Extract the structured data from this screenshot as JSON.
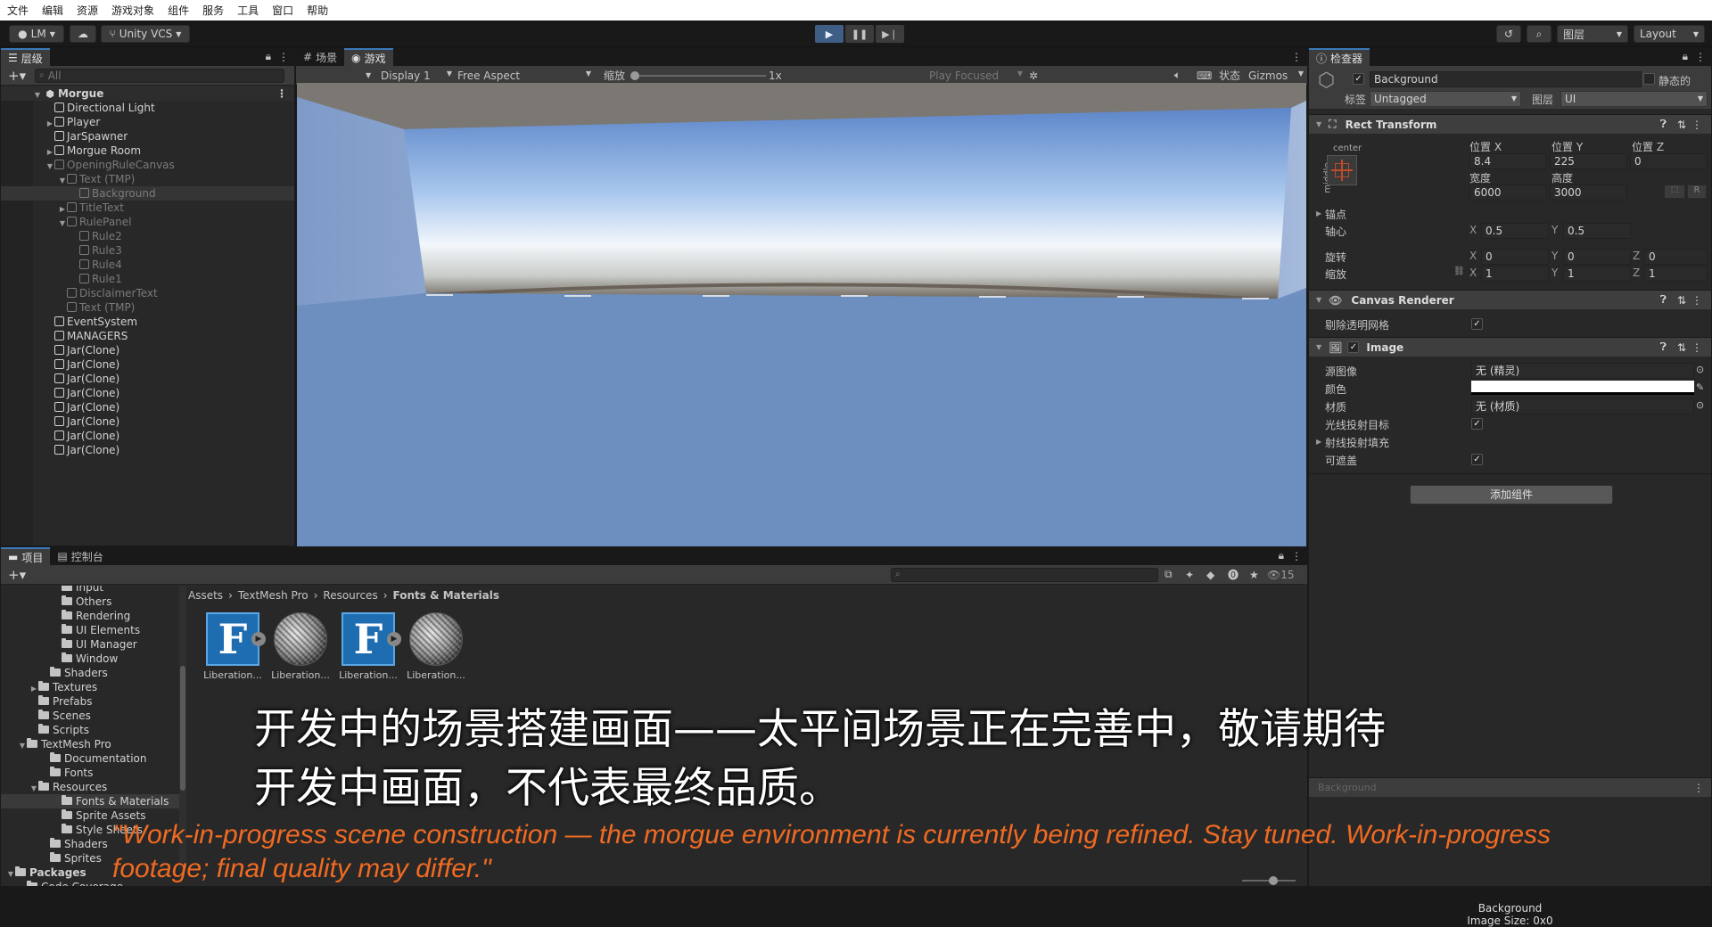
{
  "menubar": [
    "文件",
    "编辑",
    "资源",
    "游戏对象",
    "组件",
    "服务",
    "工具",
    "窗口",
    "帮助"
  ],
  "toolbar": {
    "account": "LM",
    "vcs": "Unity VCS",
    "layers": "图层",
    "layout": "Layout"
  },
  "hierarchy": {
    "tab": "层级",
    "search_placeholder": "All",
    "scene": "Morgue",
    "items": [
      {
        "label": "Directional Light",
        "indent": 1,
        "arrow": "",
        "dim": false
      },
      {
        "label": "Player",
        "indent": 1,
        "arrow": "▶",
        "dim": false
      },
      {
        "label": "JarSpawner",
        "indent": 1,
        "arrow": "",
        "dim": false
      },
      {
        "label": "Morgue Room",
        "indent": 1,
        "arrow": "▶",
        "dim": false
      },
      {
        "label": "OpeningRuleCanvas",
        "indent": 1,
        "arrow": "▼",
        "dim": true
      },
      {
        "label": "Text (TMP)",
        "indent": 2,
        "arrow": "▼",
        "dim": true
      },
      {
        "label": "Background",
        "indent": 3,
        "arrow": "",
        "dim": true,
        "selected": true
      },
      {
        "label": "TitleText",
        "indent": 2,
        "arrow": "▶",
        "dim": true
      },
      {
        "label": "RulePanel",
        "indent": 2,
        "arrow": "▼",
        "dim": true
      },
      {
        "label": "Rule2",
        "indent": 3,
        "arrow": "",
        "dim": true
      },
      {
        "label": "Rule3",
        "indent": 3,
        "arrow": "",
        "dim": true
      },
      {
        "label": "Rule4",
        "indent": 3,
        "arrow": "",
        "dim": true
      },
      {
        "label": "Rule1",
        "indent": 3,
        "arrow": "",
        "dim": true
      },
      {
        "label": "DisclaimerText",
        "indent": 2,
        "arrow": "",
        "dim": true
      },
      {
        "label": "Text (TMP)",
        "indent": 2,
        "arrow": "",
        "dim": true
      },
      {
        "label": "EventSystem",
        "indent": 1,
        "arrow": "",
        "dim": false
      },
      {
        "label": "MANAGERS",
        "indent": 1,
        "arrow": "",
        "dim": false
      },
      {
        "label": "Jar(Clone)",
        "indent": 1,
        "arrow": "",
        "dim": false
      },
      {
        "label": "Jar(Clone)",
        "indent": 1,
        "arrow": "",
        "dim": false
      },
      {
        "label": "Jar(Clone)",
        "indent": 1,
        "arrow": "",
        "dim": false
      },
      {
        "label": "Jar(Clone)",
        "indent": 1,
        "arrow": "",
        "dim": false
      },
      {
        "label": "Jar(Clone)",
        "indent": 1,
        "arrow": "",
        "dim": false
      },
      {
        "label": "Jar(Clone)",
        "indent": 1,
        "arrow": "",
        "dim": false
      },
      {
        "label": "Jar(Clone)",
        "indent": 1,
        "arrow": "",
        "dim": false
      },
      {
        "label": "Jar(Clone)",
        "indent": 1,
        "arrow": "",
        "dim": false
      }
    ]
  },
  "game": {
    "tab_scene": "场景",
    "tab_game": "游戏",
    "display": "Display 1",
    "aspect": "Free Aspect",
    "scale_label": "缩放",
    "scale_value": "1x",
    "play_focused": "Play Focused",
    "stats": "状态",
    "gizmos": "Gizmos"
  },
  "inspector": {
    "tab": "检查器",
    "object_name": "Background",
    "static": "静态的",
    "tag_label": "标签",
    "tag": "Untagged",
    "layer_label": "图层",
    "layer": "UI",
    "rect": {
      "title": "Rect Transform",
      "anchor_h": "center",
      "anchor_v": "middle",
      "pos_x_label": "位置 X",
      "pos_y_label": "位置 Y",
      "pos_z_label": "位置 Z",
      "pos_x": "8.4",
      "pos_y": "225",
      "pos_z": "0",
      "width_label": "宽度",
      "height_label": "高度",
      "width": "6000",
      "height": "3000",
      "anchors": "锚点",
      "pivot": "轴心",
      "pivot_x": "0.5",
      "pivot_y": "0.5",
      "rotation": "旋转",
      "rot_x": "0",
      "rot_y": "0",
      "rot_z": "0",
      "scale": "缩放",
      "scale_x": "1",
      "scale_y": "1",
      "scale_z": "1",
      "x": "X",
      "y": "Y",
      "z": "Z",
      "r": "R"
    },
    "canvas_renderer": {
      "title": "Canvas Renderer",
      "cull": "剔除透明网格"
    },
    "image": {
      "title": "Image",
      "source_label": "源图像",
      "source": "无 (精灵)",
      "color_label": "颜色",
      "material_label": "材质",
      "material": "无 (材质)",
      "raycast_target": "光线投射目标",
      "raycast_padding": "射线投射填充",
      "maskable": "可遮盖"
    },
    "add_component": "添加组件",
    "preview_label": "Background",
    "preview_name": "Background",
    "preview_size": "Image Size: 0x0"
  },
  "project": {
    "tab_project": "项目",
    "tab_console": "控制台",
    "count": "15",
    "breadcrumb": [
      "Assets",
      "TextMesh Pro",
      "Resources",
      "Fonts & Materials"
    ],
    "tree": [
      {
        "label": "Input",
        "indent": 4
      },
      {
        "label": "Others",
        "indent": 4
      },
      {
        "label": "Rendering",
        "indent": 4
      },
      {
        "label": "UI Elements",
        "indent": 4
      },
      {
        "label": "UI Manager",
        "indent": 4
      },
      {
        "label": "Window",
        "indent": 4
      },
      {
        "label": "Shaders",
        "indent": 3
      },
      {
        "label": "Textures",
        "indent": 2,
        "arrow": "▶"
      },
      {
        "label": "Prefabs",
        "indent": 2
      },
      {
        "label": "Scenes",
        "indent": 2
      },
      {
        "label": "Scripts",
        "indent": 2
      },
      {
        "label": "TextMesh Pro",
        "indent": 1,
        "arrow": "▼"
      },
      {
        "label": "Documentation",
        "indent": 3
      },
      {
        "label": "Fonts",
        "indent": 3
      },
      {
        "label": "Resources",
        "indent": 2,
        "arrow": "▼"
      },
      {
        "label": "Fonts & Materials",
        "indent": 4,
        "selected": true
      },
      {
        "label": "Sprite Assets",
        "indent": 4
      },
      {
        "label": "Style Sheets",
        "indent": 4
      },
      {
        "label": "Shaders",
        "indent": 3
      },
      {
        "label": "Sprites",
        "indent": 3
      },
      {
        "label": "Packages",
        "indent": 0,
        "arrow": "▼",
        "bold": true
      },
      {
        "label": "Code Coverage",
        "indent": 1,
        "arrow": "▶"
      }
    ],
    "assets": [
      {
        "label": "Liberation...",
        "kind": "font"
      },
      {
        "label": "Liberation...",
        "kind": "material"
      },
      {
        "label": "Liberation...",
        "kind": "font"
      },
      {
        "label": "Liberation...",
        "kind": "material"
      }
    ]
  },
  "subtitles": {
    "zh_line1": "开发中的场景搭建画面——太平间场景正在完善中，敬请期待",
    "zh_line2": "开发中画面，不代表最终品质。",
    "en_line1": "\"Work-in-progress scene construction — the morgue environment is currently being refined. Stay tuned. Work-in-progress",
    "en_line2": "footage; final quality may differ.\""
  },
  "colors": {
    "accent": "#3a79bb",
    "subtitle_en": "#f06a22",
    "game_floor": "#6c8fbf"
  }
}
